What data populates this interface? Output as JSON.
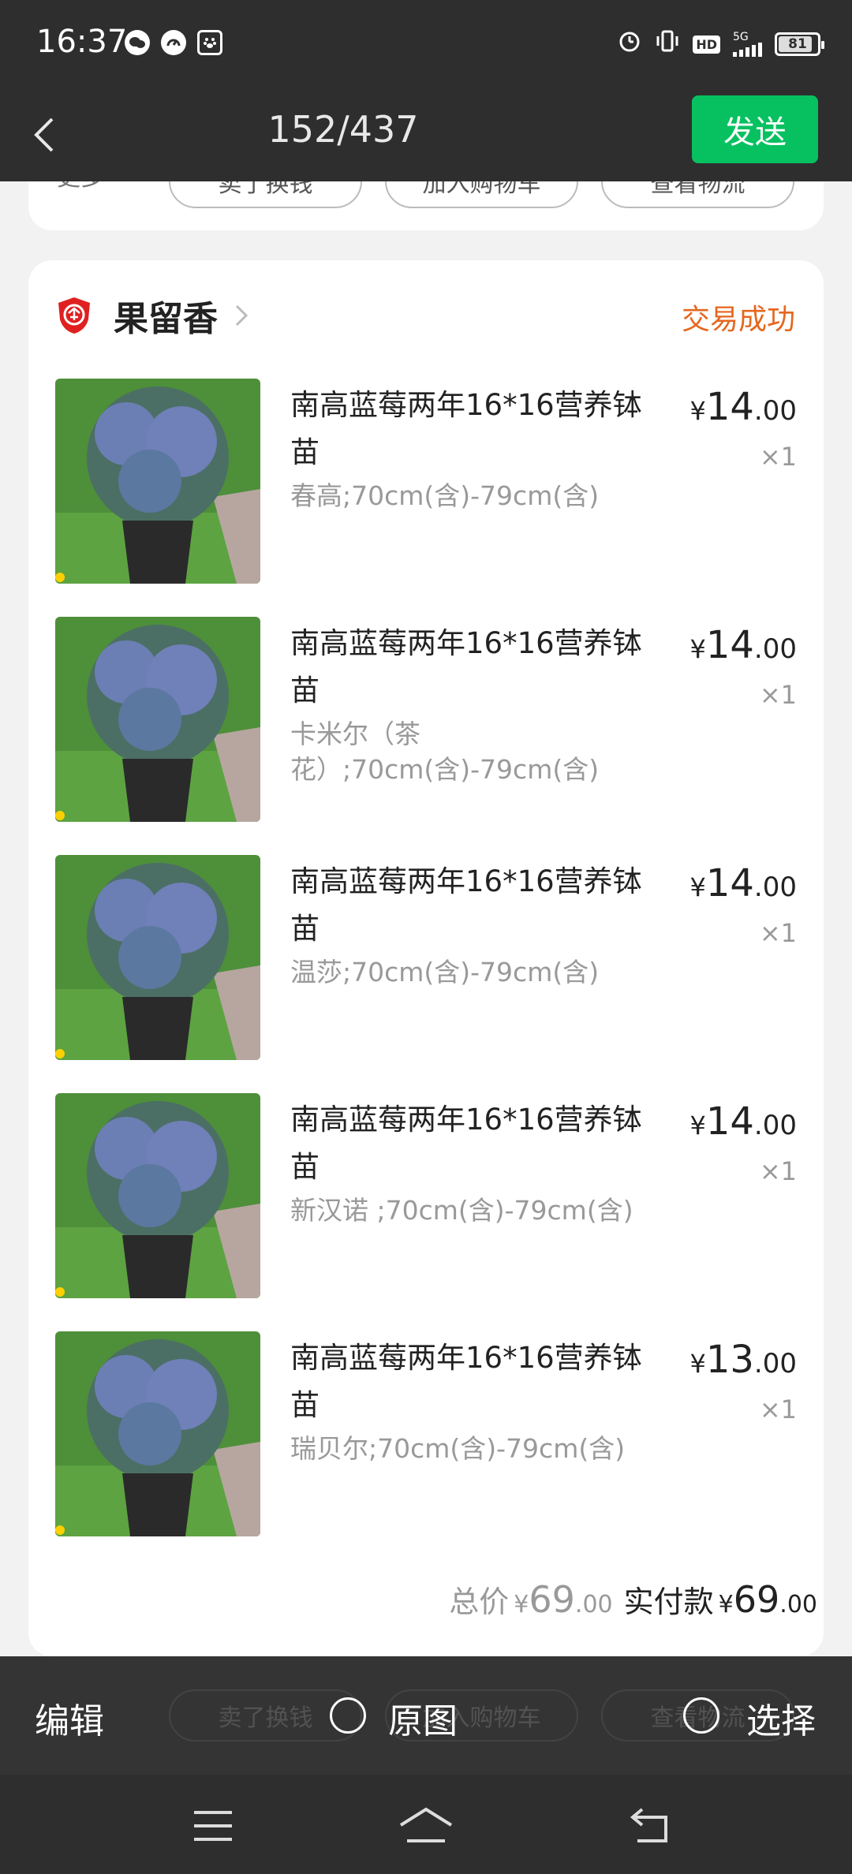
{
  "status_bar": {
    "time": "16:37",
    "network": "5G",
    "hd": "HD",
    "battery": "81",
    "left_icons": [
      "wechat-icon",
      "speedometer-icon",
      "paw-app-icon"
    ],
    "right_icons": [
      "alarm-icon",
      "vibrate-icon"
    ]
  },
  "header": {
    "counter": "152/437",
    "send_label": "发送"
  },
  "prev_card": {
    "more_label": "更多",
    "buttons": [
      "卖了换钱",
      "加入购物车",
      "查看物流"
    ]
  },
  "order": {
    "store_name": "果留香",
    "status": "交易成功",
    "items": [
      {
        "title": "南高蓝莓两年16*16营养钵苗",
        "spec": "春高;70cm(含)-79cm(含)",
        "price_int": "14",
        "price_dec": ".00",
        "qty": "×1"
      },
      {
        "title": "南高蓝莓两年16*16营养钵苗",
        "spec": "卡米尔（茶花）;70cm(含)-79cm(含)",
        "price_int": "14",
        "price_dec": ".00",
        "qty": "×1"
      },
      {
        "title": "南高蓝莓两年16*16营养钵苗",
        "spec": "温莎;70cm(含)-79cm(含)",
        "price_int": "14",
        "price_dec": ".00",
        "qty": "×1"
      },
      {
        "title": "南高蓝莓两年16*16营养钵苗",
        "spec": "新汉诺 ;70cm(含)-79cm(含)",
        "price_int": "14",
        "price_dec": ".00",
        "qty": "×1"
      },
      {
        "title": "南高蓝莓两年16*16营养钵苗",
        "spec": "瑞贝尔;70cm(含)-79cm(含)",
        "price_int": "13",
        "price_dec": ".00",
        "qty": "×1"
      }
    ],
    "currency": "¥",
    "total_label": "总价",
    "total_int": "69",
    "total_dec": ".00",
    "paid_label": "实付款",
    "paid_int": "69",
    "paid_dec": ".00"
  },
  "bottom_bar": {
    "edit_label": "编辑",
    "original_label": "原图",
    "select_label": "选择",
    "under_buttons": [
      "卖了换钱",
      "加入购物车",
      "查看物流"
    ]
  },
  "colors": {
    "dark_bg": "#2e2e2e",
    "accent_green": "#07c160",
    "status_orange": "#e5671f",
    "badge_red": "#e02020"
  }
}
